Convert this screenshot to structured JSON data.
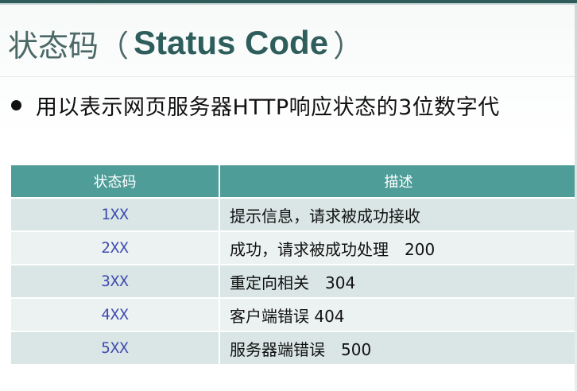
{
  "slide": {
    "title_cn": "状态码",
    "title_open_paren": "（",
    "title_en": "Status Code",
    "title_close_paren": "）",
    "bullet_text": "用以表示网页服务器HTTP响应状态的3位数字代",
    "accent_color": "#4e9d98",
    "code_text_color": "#3f4bb0"
  },
  "table": {
    "headers": [
      "状态码",
      "描述"
    ],
    "rows": [
      {
        "code": "1XX",
        "desc": "提示信息，请求被成功接收"
      },
      {
        "code": "2XX",
        "desc": "成功，请求被成功处理　200"
      },
      {
        "code": "3XX",
        "desc": "重定向相关　304"
      },
      {
        "code": "4XX",
        "desc": "客户端错误 404"
      },
      {
        "code": "5XX",
        "desc": "服务器端错误　500"
      }
    ]
  }
}
